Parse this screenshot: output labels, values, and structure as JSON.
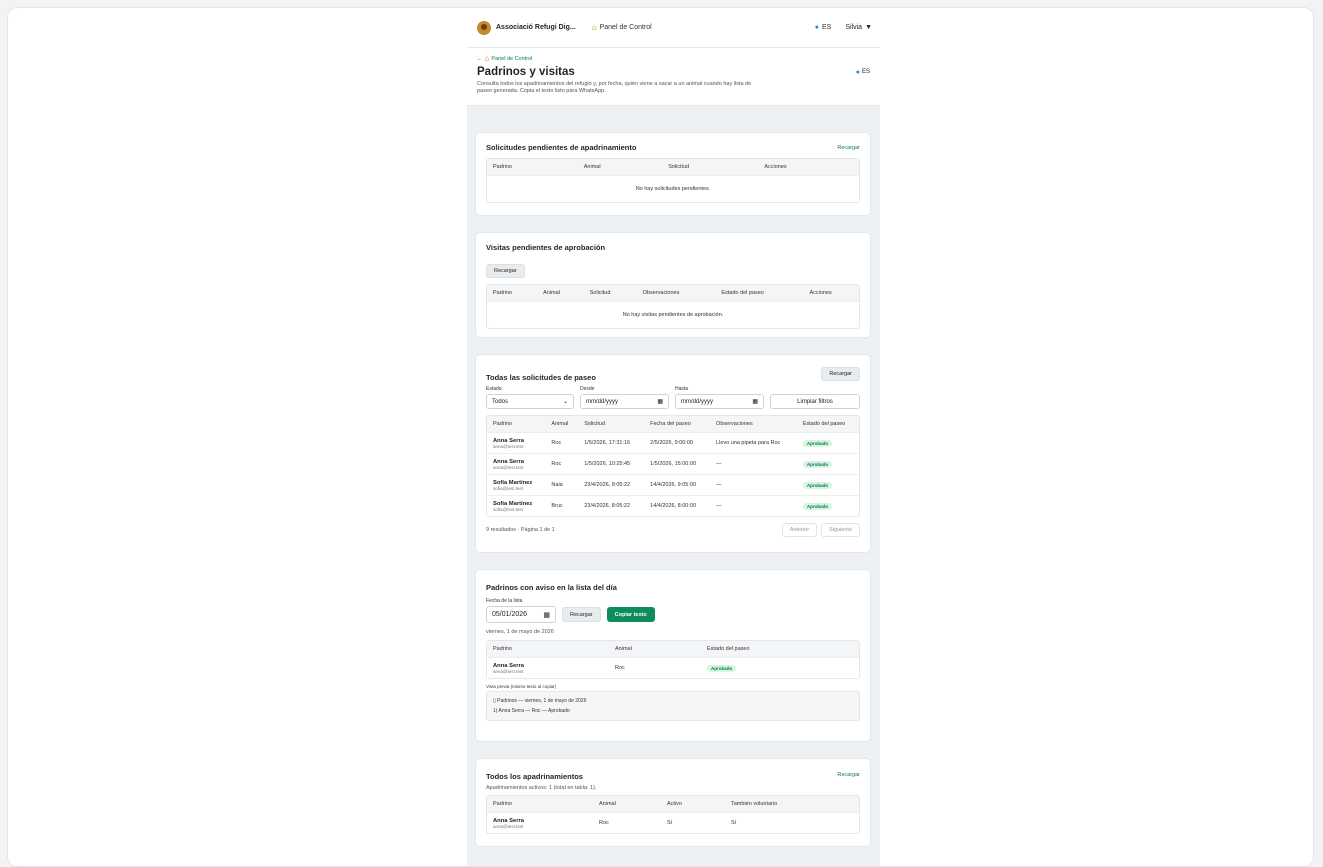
{
  "topbar": {
    "brand": "Associació Refugi Dig...",
    "nav_label": "Panel de Control",
    "lang": "ES",
    "user": "Silvia"
  },
  "header": {
    "back_label": "Panel de Control",
    "title": "Padrinos y visitas",
    "description": "Consulta todos los apadrinamientos del refugio y, por fecha, quién viene a sacar a un animal cuando hay lista de paseo generada. Copia el texto listo para WhatsApp.",
    "lang": "ES"
  },
  "pending_requests": {
    "title": "Solicitudes pendientes de apadrinamiento",
    "reload": "Recargar",
    "columns": [
      "Padrino",
      "Animal",
      "Solicitud",
      "Acciones"
    ],
    "empty": "No hay solicitudes pendientes."
  },
  "pending_visits": {
    "title": "Visitas pendientes de aprobación",
    "reload": "Recargar",
    "columns": [
      "Padrino",
      "Animal",
      "Solicitud",
      "Observaciones",
      "Estado del paseo",
      "Acciones"
    ],
    "empty": "No hay visitas pendientes de aprobación."
  },
  "all_walks": {
    "title": "Todas las solicitudes de paseo",
    "reload": "Recargar",
    "filters": {
      "estado_label": "Estado",
      "estado_value": "Todos",
      "desde_label": "Desde",
      "desde_placeholder": "mm/dd/yyyy",
      "hasta_label": "Hasta",
      "hasta_placeholder": "mm/dd/yyyy",
      "clear": "Limpiar filtros"
    },
    "columns": [
      "Padrino",
      "Animal",
      "Solicitud",
      "Fecha del paseo",
      "Observaciones",
      "Estado del paseo"
    ],
    "rows": [
      {
        "name": "Anna Serra",
        "email": "anna@test.test",
        "animal": "Roc",
        "solicitud": "1/5/2026, 17:31:16",
        "fecha": "2/5/2026, 9:00:00",
        "obs": "Llevo una pipeta para Roc",
        "estado": "Aprobado"
      },
      {
        "name": "Anna Serra",
        "email": "anna@test.test",
        "animal": "Roc",
        "solicitud": "1/5/2026, 10:25:45",
        "fecha": "1/5/2026, 15:00:00",
        "obs": "—",
        "estado": "Aprobado"
      },
      {
        "name": "Sofia Martínez",
        "email": "sofia@test.test",
        "animal": "Naia",
        "solicitud": "23/4/2026, 8:05:22",
        "fecha": "14/4/2026, 9:05:00",
        "obs": "—",
        "estado": "Aprobado"
      },
      {
        "name": "Sofia Martínez",
        "email": "sofia@test.test",
        "animal": "Bruc",
        "solicitud": "23/4/2026, 8:05:22",
        "fecha": "14/4/2026, 8:00:00",
        "obs": "—",
        "estado": "Aprobado"
      }
    ],
    "results": "9 resultados · Página 1 de 1",
    "prev": "Anterior",
    "next": "Siguiente"
  },
  "daily_list": {
    "title": "Padrinos con aviso en la lista del día",
    "date_label": "Fecha de la lista",
    "date_value": "05/01/2026",
    "reload": "Recargar",
    "copy": "Copiar texto",
    "day_text": "viernes, 1 de mayo de 2026",
    "columns": [
      "Padrino",
      "Animal",
      "Estado del paseo"
    ],
    "rows": [
      {
        "name": "Anna Serra",
        "email": "anna@test.test",
        "animal": "Roc",
        "estado": "Aprobado"
      }
    ],
    "preview_label": "Vista previa (mismo texto al copiar)",
    "preview_line1": "Padrinos — viernes, 1 de mayo de 2026",
    "preview_line2": "1) Anna Serra — Roc — Aprobado"
  },
  "all_sponsorships": {
    "title": "Todos los apadrinamientos",
    "reload": "Recargar",
    "summary": "Apadrinamientos activos: 1 (total en tabla: 1).",
    "columns": [
      "Padrino",
      "Animal",
      "Activo",
      "También voluntario"
    ],
    "rows": [
      {
        "name": "Anna Serra",
        "email": "anna@test.test",
        "animal": "Roc",
        "activo": "Sí",
        "voluntario": "Sí"
      }
    ]
  }
}
